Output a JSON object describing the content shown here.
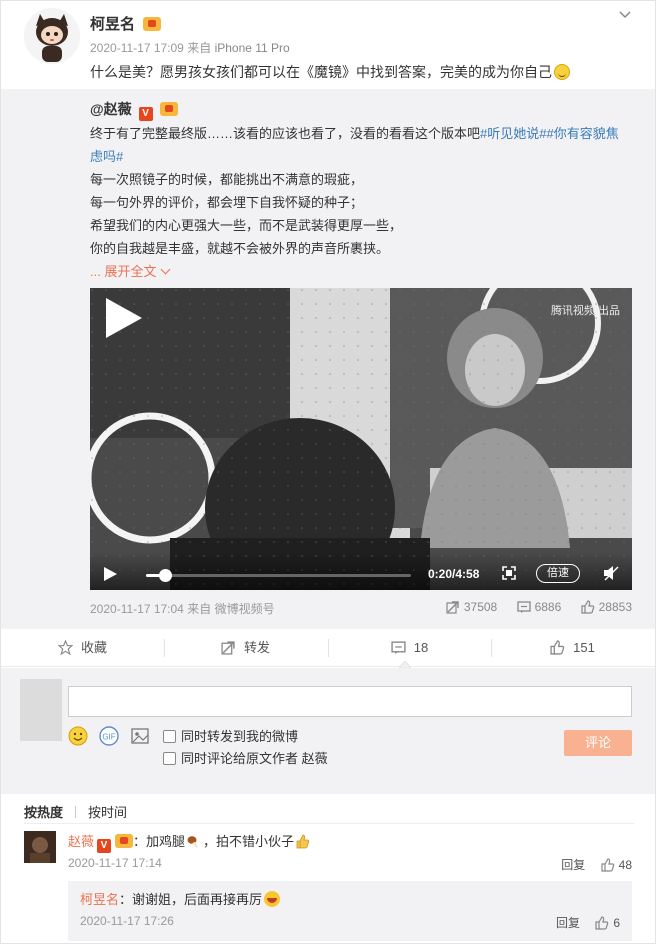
{
  "post": {
    "username": "柯昱名",
    "timestamp": "2020-11-17 17:09",
    "source_prefix": "来自",
    "source": "iPhone 11 Pro",
    "text": "什么是美？愿男孩女孩们都可以在《魔镜》中找到答案，完美的成为你自己"
  },
  "original": {
    "username": "@赵薇",
    "v_badge": "V",
    "line1_plain": "终于有了完整最终版……该看的应该也看了，没看的看看这个版本吧",
    "tag1": "#听见她说#",
    "tag2": "#你有容貌焦",
    "tag2_cont": "虑吗#",
    "line2": "每一次照镜子的时候，都能挑出不满意的瑕疵，",
    "line3": "每一句外界的评价，都会埋下自我怀疑的种子；",
    "line4": "希望我们的内心更强大一些，而不是武装得更厚一些，",
    "line5": "你的自我越是丰盛，就越不会被外界的声音所裹挟。",
    "expand": "... 展开全文",
    "video": {
      "watermark": "腾讯视频",
      "watermark_badge": "出品",
      "time": "0:20/4:58",
      "progress": 0.07,
      "speed": "倍速"
    },
    "footer_time": "2020-11-17 17:04",
    "footer_source_prefix": "来自",
    "footer_source": "微博视频号",
    "reposts": "37508",
    "comments": "6886",
    "likes": "28853"
  },
  "actions": {
    "favorite": "收藏",
    "repost": "转发",
    "comment": "18",
    "like": "151"
  },
  "composer": {
    "placeholder": "",
    "option1": "同时转发到我的微博",
    "option2": "同时评论给原文作者 赵薇",
    "submit": "评论"
  },
  "sort": {
    "hot": "按热度",
    "time": "按时间"
  },
  "comments": [
    {
      "user": "赵薇",
      "sep": "：",
      "text_a": "加鸡腿",
      "text_b": "，拍不错小伙子",
      "time": "2020-11-17 17:14",
      "reply": "回复",
      "likes": "48"
    }
  ],
  "reply": {
    "user": "柯昱名",
    "sep": "：",
    "text": "谢谢姐，后面再接再厉",
    "time": "2020-11-17 17:26",
    "reply": "回复",
    "likes": "6"
  }
}
